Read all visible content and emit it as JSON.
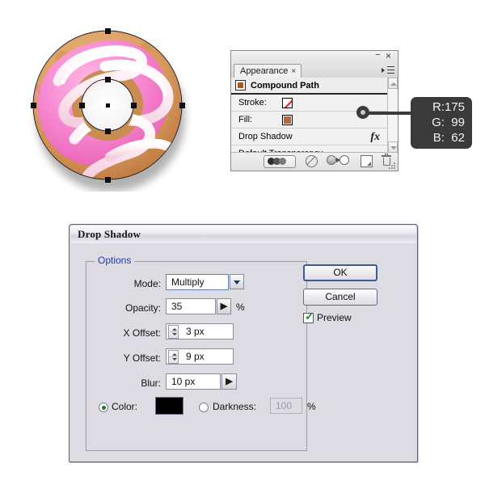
{
  "illustration": {
    "name": "donut-artwork",
    "description": "Pink glazed donut with white icing swirls, selected in Illustrator",
    "colors": {
      "dough": "#d79a5a",
      "dough_dark": "#b06b42",
      "glaze_pink": "#f58fd0",
      "glaze_pink_light": "#ffb3e0",
      "icing_white": "#fdeef2",
      "hole": "#ffffff"
    }
  },
  "appearance_panel": {
    "tab_label": "Appearance",
    "tab_close_glyph": "×",
    "minimize_glyph": "−",
    "close_glyph": "×",
    "rows": [
      {
        "label": "Compound Path",
        "type": "header"
      },
      {
        "label": "Stroke:",
        "type": "stroke",
        "swatch": "none"
      },
      {
        "label": "Fill:",
        "type": "fill",
        "swatch": "#b06b42"
      },
      {
        "label": "Drop Shadow",
        "type": "effect",
        "badge": "fx"
      },
      {
        "label": "Default Transparency",
        "type": "transparency"
      }
    ],
    "bottom_buttons": [
      "opacity-button",
      "clear-appearance-button",
      "duplicate-item-button",
      "new-art-has-basic-appearance-button",
      "delete-item-button"
    ]
  },
  "rgb_callout": {
    "r": "R:175",
    "g": "G:  99",
    "b": "B:  62",
    "hex": "#AF633E"
  },
  "drop_shadow_dialog": {
    "title": "Drop Shadow",
    "options_legend": "Options",
    "fields": {
      "mode_label": "Mode:",
      "mode_value": "Multiply",
      "opacity_label": "Opacity:",
      "opacity_value": "35",
      "opacity_unit": "%",
      "x_offset_label": "X Offset:",
      "x_offset_value": "3 px",
      "y_offset_label": "Y Offset:",
      "y_offset_value": "9 px",
      "blur_label": "Blur:",
      "blur_value": "10 px",
      "color_label": "Color:",
      "color_value": "#000000",
      "darkness_label": "Darkness:",
      "darkness_value": "100",
      "darkness_unit": "%"
    },
    "buttons": {
      "ok": "OK",
      "cancel": "Cancel"
    },
    "preview_label": "Preview",
    "preview_checked": true,
    "selected_color_mode": "Color"
  }
}
